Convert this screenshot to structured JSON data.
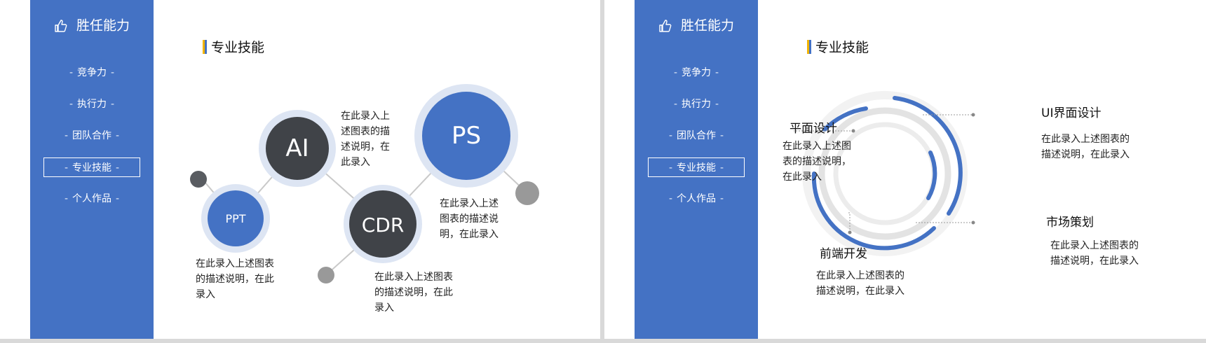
{
  "sidebar": {
    "title": "胜任能力",
    "items": [
      {
        "label": "竞争力"
      },
      {
        "label": "执行力"
      },
      {
        "label": "团队合作"
      },
      {
        "label": "专业技能"
      },
      {
        "label": "个人作品"
      }
    ],
    "dash": "-"
  },
  "left_slide": {
    "section_title": "专业技能",
    "nodes": [
      {
        "label": "AI"
      },
      {
        "label": "PS"
      },
      {
        "label": "PPT"
      },
      {
        "label": "CDR"
      }
    ],
    "desc_ai": "在此录入上述图表的描述说明，在此录入",
    "desc_ps": "在此录入上述图表的描述说明，在此录入",
    "desc_ppt": "在此录入上述图表的描述说明，在此录入",
    "desc_cdr": "在此录入上述图表的描述说明，在此录入"
  },
  "right_slide": {
    "section_title": "专业技能",
    "items": [
      {
        "title": "平面设计",
        "desc": "在此录入上述图表的描述说明，在此录入"
      },
      {
        "title": "UI界面设计",
        "desc": "在此录入上述图表的描述说明，在此录入"
      },
      {
        "title": "市场策划",
        "desc": "在此录入上述图表的描述说明，在此录入"
      },
      {
        "title": "前端开发",
        "desc": "在此录入上述图表的描述说明，在此录入"
      }
    ]
  },
  "colors": {
    "accent": "#4472c4",
    "dark": "#404348",
    "gray": "#8c8c8c",
    "yellow": "#f2b400"
  },
  "icons": {
    "sidebar_title": "thumbs-up-icon"
  }
}
